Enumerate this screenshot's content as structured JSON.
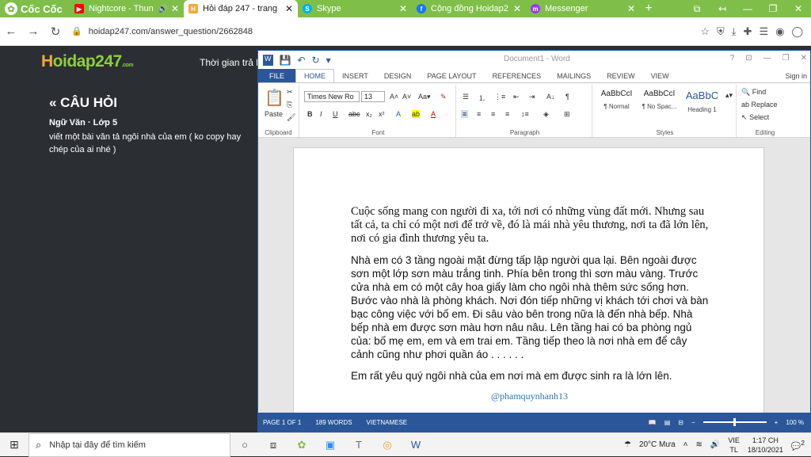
{
  "browser": {
    "brand": "Cốc Cốc",
    "tabs": [
      {
        "title": "Nightcore - Thun",
        "fav_color": "#ff0000",
        "fav_text": "▶"
      },
      {
        "title": "Hỏi đáp 247 - trang",
        "fav_color": "#f2a93b",
        "fav_text": "H"
      },
      {
        "title": "Skype",
        "fav_color": "#00aff0",
        "fav_text": "S"
      },
      {
        "title": "Cộng đồng Hoidap2",
        "fav_color": "#1877f2",
        "fav_text": "f"
      },
      {
        "title": "Messenger",
        "fav_color": "#a033ff",
        "fav_text": "m"
      }
    ],
    "url": "hoidap247.com/answer_question/2662848",
    "accent": "#7fbf49"
  },
  "site": {
    "logo_main": "oidap247",
    "logo_h": "H",
    "logo_sub": ".com",
    "time_label": "Thời gian trả l",
    "heading": "« CÂU HỎI",
    "subject": "Ngữ Văn · Lớp 5",
    "question": "viết một bài văn tả ngôi nhà của em ( ko copy hay chép của ai nhé )"
  },
  "word": {
    "doc_title": "Document1 - Word",
    "tabs": [
      "FILE",
      "HOME",
      "INSERT",
      "DESIGN",
      "PAGE LAYOUT",
      "REFERENCES",
      "MAILINGS",
      "REVIEW",
      "VIEW"
    ],
    "sign_in": "Sign in",
    "font_name": "Times New Ro",
    "font_size": "13",
    "groups": {
      "clipboard": "Clipboard",
      "font": "Font",
      "paragraph": "Paragraph",
      "styles": "Styles",
      "editing": "Editing"
    },
    "paste": "Paste",
    "styles": [
      {
        "preview": "AaBbCcI",
        "label": "¶ Normal"
      },
      {
        "preview": "AaBbCcI",
        "label": "¶ No Spac..."
      },
      {
        "preview": "AaBbC",
        "label": "Heading 1"
      }
    ],
    "editing": {
      "find": "Find",
      "replace": "Replace",
      "select": "Select"
    },
    "paragraphs": [
      "Cuộc sống mang con người đi xa, tới nơi có những vùng đất mới. Nhưng sau tất cả, ta chỉ có một nơi để trở về, đó là mái nhà yêu thương, nơi ta đã lớn lên, nơi có gia đình thương yêu ta.",
      "Nhà em có 3 tầng ngoài mặt đừng tấp lập người qua lại. Bên ngoài được sơn một lớp sơn màu trắng tinh. Phía bên trong thì sơn màu vàng. Trước cửa nhà em có một cây hoa giấy làm cho ngôi nhà thêm sức sống hơn. Bước vào nhà là phòng khách. Nơi đón tiếp những vị khách tới chơi và bàn bạc công việc với bố em. Đi sâu vào bên trong nữa là đến nhà bếp. Nhà bếp nhà em được sơn màu hơn nâu nâu. Lên tầng hai có ba phòng ngủ của: bố mẹ em, em và em trai em. Tầng tiếp theo là nơi nhà em để cây cảnh cũng như phơi quần áo . . . . . .",
      "Em rất yêu quý ngôi nhà của em nơi mà em được sinh ra là lớn lên."
    ],
    "signature": "@phamquynhanh13",
    "status": {
      "page": "PAGE 1 OF 1",
      "words": "189 WORDS",
      "lang": "VIETNAMESE",
      "zoom": "100 %"
    },
    "zoom_fraction": 0.5,
    "accent": "#2b579a"
  },
  "taskbar": {
    "search_placeholder": "Nhập tại đây để tìm kiếm",
    "weather": "20°C Mưa",
    "lang1": "VIE",
    "lang2": "TL",
    "time": "1:17 CH",
    "date": "18/10/2021",
    "notif_count": "2"
  }
}
